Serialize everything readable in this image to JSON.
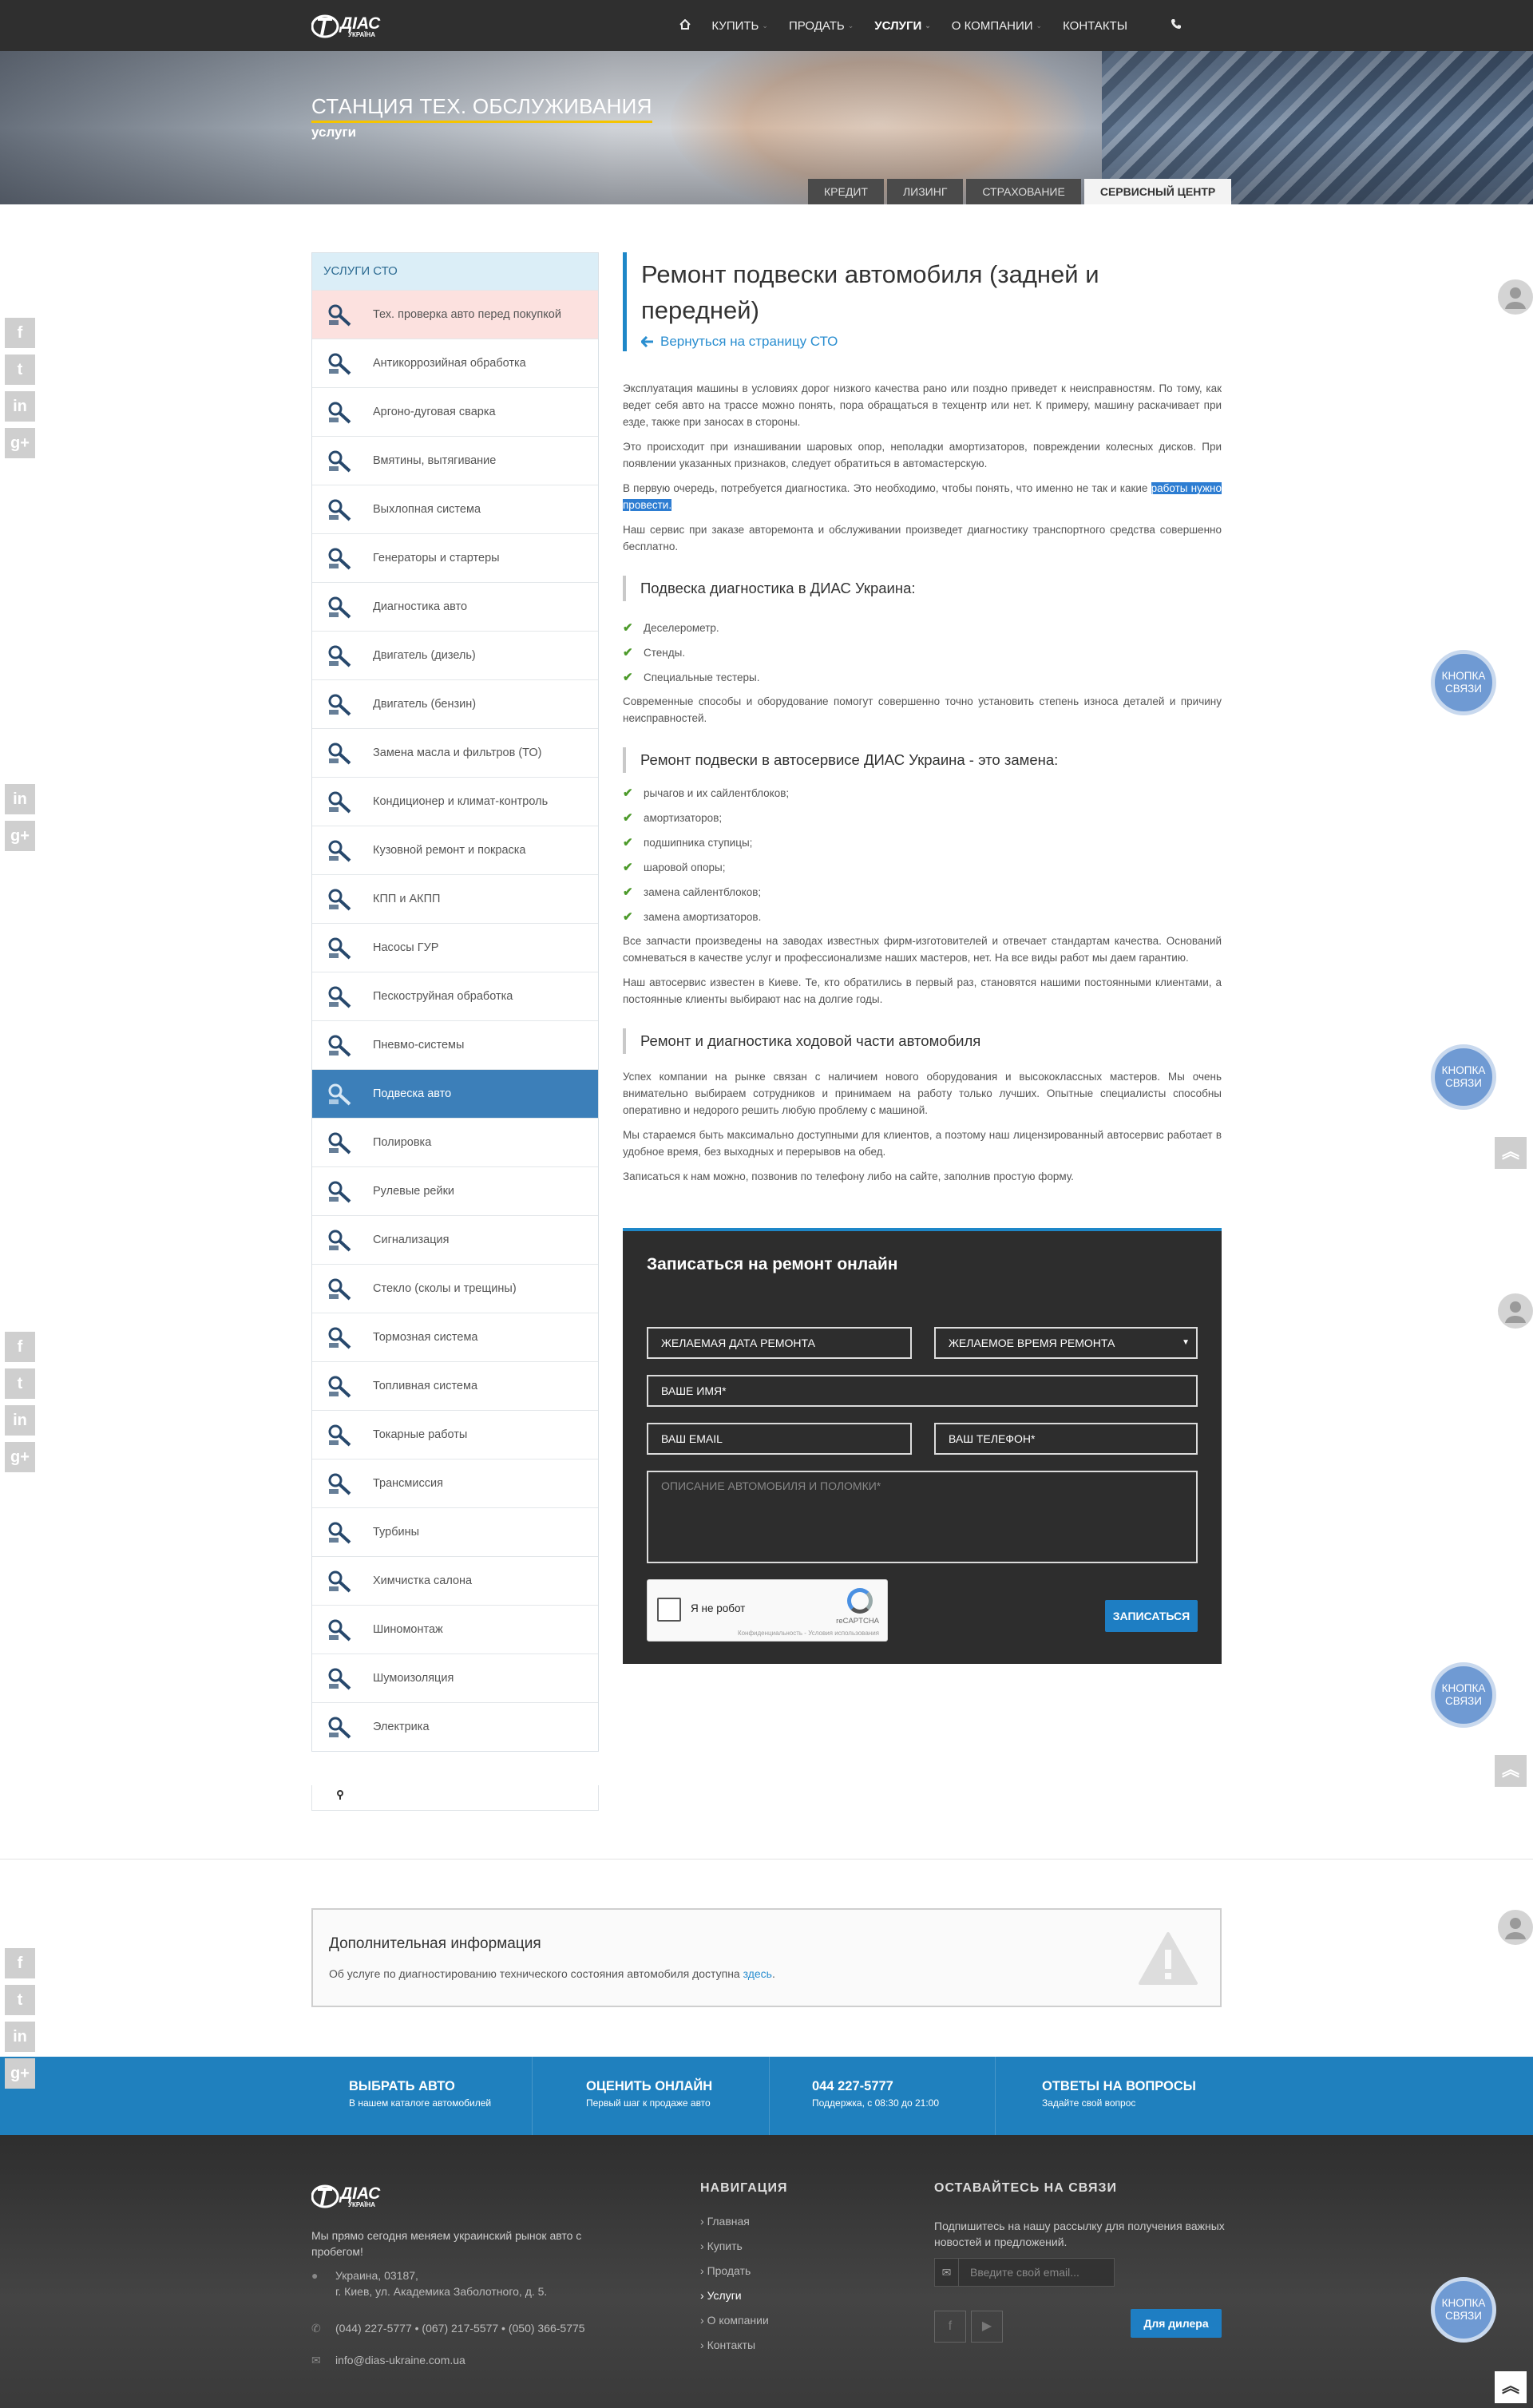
{
  "header": {
    "brand_main": "ДІАС",
    "brand_sub": "УКРАЇНА",
    "nav": [
      {
        "label": "КУПИТЬ",
        "dropdown": true,
        "active": false
      },
      {
        "label": "ПРОДАТЬ",
        "dropdown": true,
        "active": false
      },
      {
        "label": "УСЛУГИ",
        "dropdown": true,
        "active": true
      },
      {
        "label": "О КОМПАНИИ",
        "dropdown": true,
        "active": false
      },
      {
        "label": "КОНТАКТЫ",
        "dropdown": false,
        "active": false
      }
    ]
  },
  "hero": {
    "title": "СТАНЦИЯ ТЕХ. ОБСЛУЖИВАНИЯ",
    "subtitle": "услуги",
    "tabs": [
      "КРЕДИТ",
      "ЛИЗИНГ",
      "СТРАХОВАНИЕ",
      "СЕРВИСНЫЙ ЦЕНТР"
    ],
    "active_tab": 3
  },
  "sidebar": {
    "heading": "УСЛУГИ СТО",
    "items": [
      "Тех. проверка авто перед покупкой",
      "Антикоррозийная обработка",
      "Аргоно-дуговая сварка",
      "Вмятины, вытягивание",
      "Выхлопная система",
      "Генераторы и стартеры",
      "Диагностика авто",
      "Двигатель (дизель)",
      "Двигатель (бензин)",
      "Замена масла и фильтров (ТО)",
      "Кондиционер и климат-контроль",
      "Кузовной ремонт и покраска",
      "КПП и АКПП",
      "Насосы ГУР",
      "Пескоструйная обработка",
      "Пневмо-системы",
      "Подвеска авто",
      "Полировка",
      "Рулевые рейки",
      "Сигнализация",
      "Стекло (сколы и трещины)",
      "Тормозная система",
      "Топливная система",
      "Токарные работы",
      "Трансмиссия",
      "Турбины",
      "Химчистка салона",
      "Шиномонтаж",
      "Шумоизоляция",
      "Электрика"
    ],
    "selected_index": 16
  },
  "content": {
    "title": "Ремонт подвески автомобиля (задней и передней)",
    "back_link": "Вернуться на страницу СТО",
    "p1": "Эксплуатация машины в условиях дорог низкого качества рано или поздно приведет к неисправностям. По тому, как ведет себя авто на трассе можно понять, пора обращаться в техцентр или нет. К примеру, машину раскачивает при езде, также при заносах в стороны.",
    "p2": "Это происходит при изнашивании шаровых опор, неполадки амортизаторов, повреждении колесных дисков. При появлении указанных признаков, следует обратиться в автомастерскую.",
    "p3_a": "В первую очередь, потребуется диагностика. Это необходимо, чтобы понять, что именно не так и какие ",
    "p3_hl": "работы нужно провести.",
    "p4": "Наш сервис при заказе авторемонта и обслуживании произведет диагностику транспортного средства совершенно бесплатно.",
    "h1": "Подвеска диагностика в ДИАС Украина:",
    "list1": [
      "Деселерометр.",
      "Стенды.",
      "Специальные тестеры."
    ],
    "p5": "Современные способы и оборудование помогут совершенно точно установить степень износа деталей и причину неисправностей.",
    "h2": "Ремонт подвески в автосервисе ДИАС Украина - это замена:",
    "list2": [
      "рычагов и их сайлентблоков;",
      "амортизаторов;",
      "подшипника ступицы;",
      "шаровой опоры;",
      "замена сайлентблоков;",
      "замена амортизаторов."
    ],
    "p6": "Все запчасти произведены на заводах известных фирм-изготовителей и отвечает стандартам качества. Оснований сомневаться в качестве услуг и профессионализме наших мастеров, нет. На все виды работ мы даем гарантию.",
    "p7": "Наш автосервис известен в Киеве. Те, кто обратились в первый раз, становятся нашими постоянными клиентами, а постоянные клиенты выбирают нас на долгие годы.",
    "h3": "Ремонт и диагностика ходовой части автомобиля",
    "p8": "Успех компании на рынке связан с наличием нового оборудования и высококлассных мастеров. Мы очень внимательно выбираем сотрудников и принимаем на работу только лучших. Опытные специалисты способны оперативно и недорого решить любую проблему с машиной.",
    "p9": "Мы стараемся быть максимально доступными для клиентов, а поэтому наш лицензированный автосервис работает в удобное время, без выходных и перерывов на обед.",
    "p10": "Записаться к нам можно, позвонив по телефону либо на сайте, заполнив простую форму."
  },
  "form": {
    "title": "Записаться на ремонт онлайн",
    "date_placeholder": "ЖЕЛАЕМАЯ ДАТА РЕМОНТА",
    "time_placeholder": "ЖЕЛАЕМОЕ ВРЕМЯ РЕМОНТА",
    "name_placeholder": "ВАШЕ ИМЯ*",
    "email_placeholder": "ВАШ EMAIL",
    "phone_placeholder": "ВАШ ТЕЛЕФОН*",
    "desc_placeholder": "ОПИСАНИЕ АВТОМОБИЛЯ И ПОЛОМКИ*",
    "captcha_label": "Я не робот",
    "captcha_brand": "reCAPTCHA",
    "captcha_links": "Конфиденциальность - Условия использования",
    "submit": "ЗАПИСАТЬСЯ"
  },
  "info": {
    "title": "Дополнительная информация",
    "text": "Об услуге по диагностированию технического состояния автомобиля доступна ",
    "link": "здесь",
    "after": "."
  },
  "band": [
    {
      "title": "ВЫБРАТЬ АВТО",
      "sub": "В нашем каталоге автомобилей"
    },
    {
      "title": "ОЦЕНИТЬ ОНЛАЙН",
      "sub": "Первый шаг к продаже авто"
    },
    {
      "title": "044 227-5777",
      "sub": "Поддержка, с 08:30 до 21:00"
    },
    {
      "title": "ОТВЕТЫ НА ВОПРОСЫ",
      "sub": "Задайте свой вопрос"
    }
  ],
  "footer": {
    "about": "Мы прямо сегодня меняем украинский рынок авто с пробегом!",
    "address1": "Украина, 03187,",
    "address2": "г. Киев, ул. Академика Заболотного, д. 5.",
    "phones": "(044) 227-5777 • (067) 217-5577 • (050) 366-5775",
    "email": "info@dias-ukraine.com.ua",
    "nav_heading": "НАВИГАЦИЯ",
    "nav": [
      "Главная",
      "Купить",
      "Продать",
      "Услуги",
      "О компании",
      "Контакты"
    ],
    "nav_current": 3,
    "sub_heading": "ОСТАВАЙТЕСЬ НА СВЯЗИ",
    "sub_text": "Подпишитесь на нашу рассылку для получения важных новостей и предложений.",
    "email_placeholder": "Введите свой email...",
    "dealer": "Для дилера"
  },
  "float": {
    "contact_button": "КНОПКА СВЯЗИ",
    "social": [
      "f",
      "t",
      "in",
      "g+"
    ]
  },
  "colors": {
    "accent_blue": "#1e87c8",
    "header_bg": "#2f2f2f",
    "selected_item": "#3c7fb9",
    "band": "#1f80be",
    "title_underline": "#f5c400",
    "check_green": "#4c9a2a"
  }
}
